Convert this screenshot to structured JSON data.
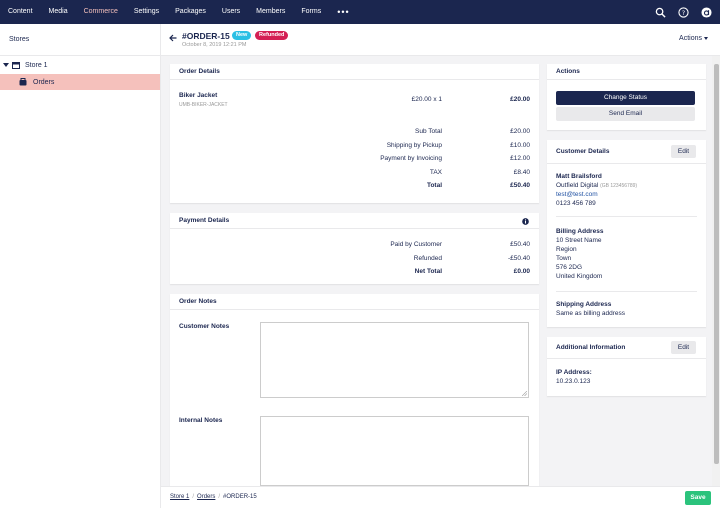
{
  "nav": {
    "items": [
      "Content",
      "Media",
      "Commerce",
      "Settings",
      "Packages",
      "Users",
      "Members",
      "Forms"
    ],
    "active": "Commerce",
    "more": "•••"
  },
  "sidebar": {
    "title": "Stores",
    "store": "Store 1",
    "orders": "Orders"
  },
  "header": {
    "order_number": "#ORDER-15",
    "date": "October 8, 2019 12:21 PM",
    "badge_new": "New",
    "badge_refunded": "Refunded",
    "actions_label": "Actions"
  },
  "order_details": {
    "title": "Order Details",
    "product_name": "Biker Jacket",
    "product_sku": "UMB-BIKER-JACKET",
    "product_qty": "£20.00 x 1",
    "product_total": "£20.00",
    "lines": [
      {
        "label": "Sub Total",
        "value": "£20.00"
      },
      {
        "label": "Shipping by Pickup",
        "value": "£10.00"
      },
      {
        "label": "Payment by Invoicing",
        "value": "£12.00"
      },
      {
        "label": "TAX",
        "value": "£8.40"
      },
      {
        "label": "Total",
        "value": "£50.40"
      }
    ]
  },
  "payment_details": {
    "title": "Payment Details",
    "lines": [
      {
        "label": "Paid by Customer",
        "value": "£50.40"
      },
      {
        "label": "Refunded",
        "value": "-£50.40"
      },
      {
        "label": "Net Total",
        "value": "£0.00"
      }
    ]
  },
  "order_notes": {
    "title": "Order Notes",
    "customer_notes_label": "Customer Notes",
    "internal_notes_label": "Internal Notes"
  },
  "actions_card": {
    "title": "Actions",
    "change_status": "Change Status",
    "send_email": "Send Email"
  },
  "customer": {
    "title": "Customer Details",
    "edit": "Edit",
    "name": "Matt Brailsford",
    "company": "Outfield Digital",
    "company_id": "(GB 123456789)",
    "email": "test@test.com",
    "phone": "0123 456 789",
    "billing_title": "Billing Address",
    "billing_lines": [
      "10 Street Name",
      "Region",
      "Town",
      "576 2DG",
      "United Kingdom"
    ],
    "shipping_title": "Shipping Address",
    "shipping_value": "Same as billing address"
  },
  "additional": {
    "title": "Additional Information",
    "edit": "Edit",
    "ip_label": "IP Address:",
    "ip_value": "10.23.0.123"
  },
  "footer": {
    "crumbs": [
      "Store 1",
      "Orders",
      "#ORDER-15"
    ],
    "save": "Save"
  },
  "colors": {
    "navy": "#1b264f",
    "active_pink": "#f5c1bc",
    "badge_new": "#2bc0e4",
    "badge_refunded": "#d42054",
    "save_green": "#2bc37c",
    "link_blue": "#2152a3"
  }
}
